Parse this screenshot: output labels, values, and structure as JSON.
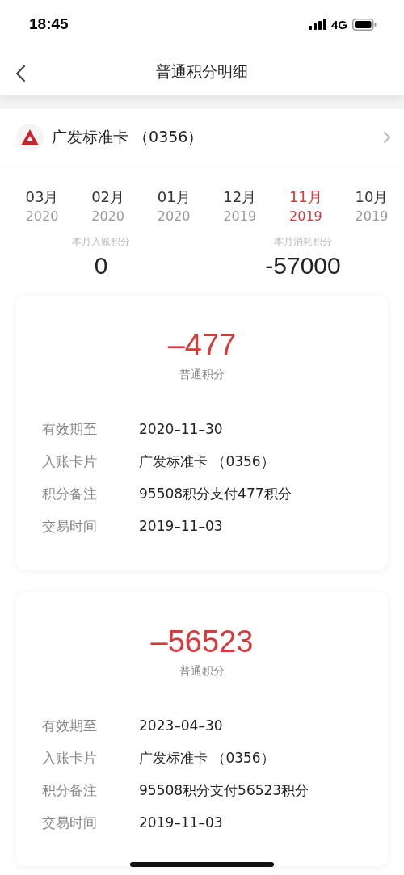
{
  "status_bar": {
    "time": "18:45",
    "network": "4G"
  },
  "nav": {
    "title": "普通积分明细"
  },
  "card_selector": {
    "name": "广发标准卡 （0356）"
  },
  "months": [
    {
      "month": "03月",
      "year": "2020",
      "selected": false
    },
    {
      "month": "02月",
      "year": "2020",
      "selected": false
    },
    {
      "month": "01月",
      "year": "2020",
      "selected": false
    },
    {
      "month": "12月",
      "year": "2019",
      "selected": false
    },
    {
      "month": "11月",
      "year": "2019",
      "selected": true
    },
    {
      "month": "10月",
      "year": "2019",
      "selected": false
    }
  ],
  "summary": [
    {
      "label": "本月入账积分",
      "value": "0"
    },
    {
      "label": "本月消耗积分",
      "value": "-57000"
    }
  ],
  "records": [
    {
      "amount": "–477",
      "type": "普通积分",
      "details": [
        {
          "label": "有效期至",
          "value": "2020–11–30"
        },
        {
          "label": "入账卡片",
          "value": "广发标准卡 （0356）"
        },
        {
          "label": "积分备注",
          "value": "95508积分支付477积分"
        },
        {
          "label": "交易时间",
          "value": "2019–11–03"
        }
      ]
    },
    {
      "amount": "–56523",
      "type": "普通积分",
      "details": [
        {
          "label": "有效期至",
          "value": "2023–04–30"
        },
        {
          "label": "入账卡片",
          "value": "广发标准卡 （0356）"
        },
        {
          "label": "积分备注",
          "value": "95508积分支付56523积分"
        },
        {
          "label": "交易时间",
          "value": "2019–11–03"
        }
      ]
    }
  ]
}
